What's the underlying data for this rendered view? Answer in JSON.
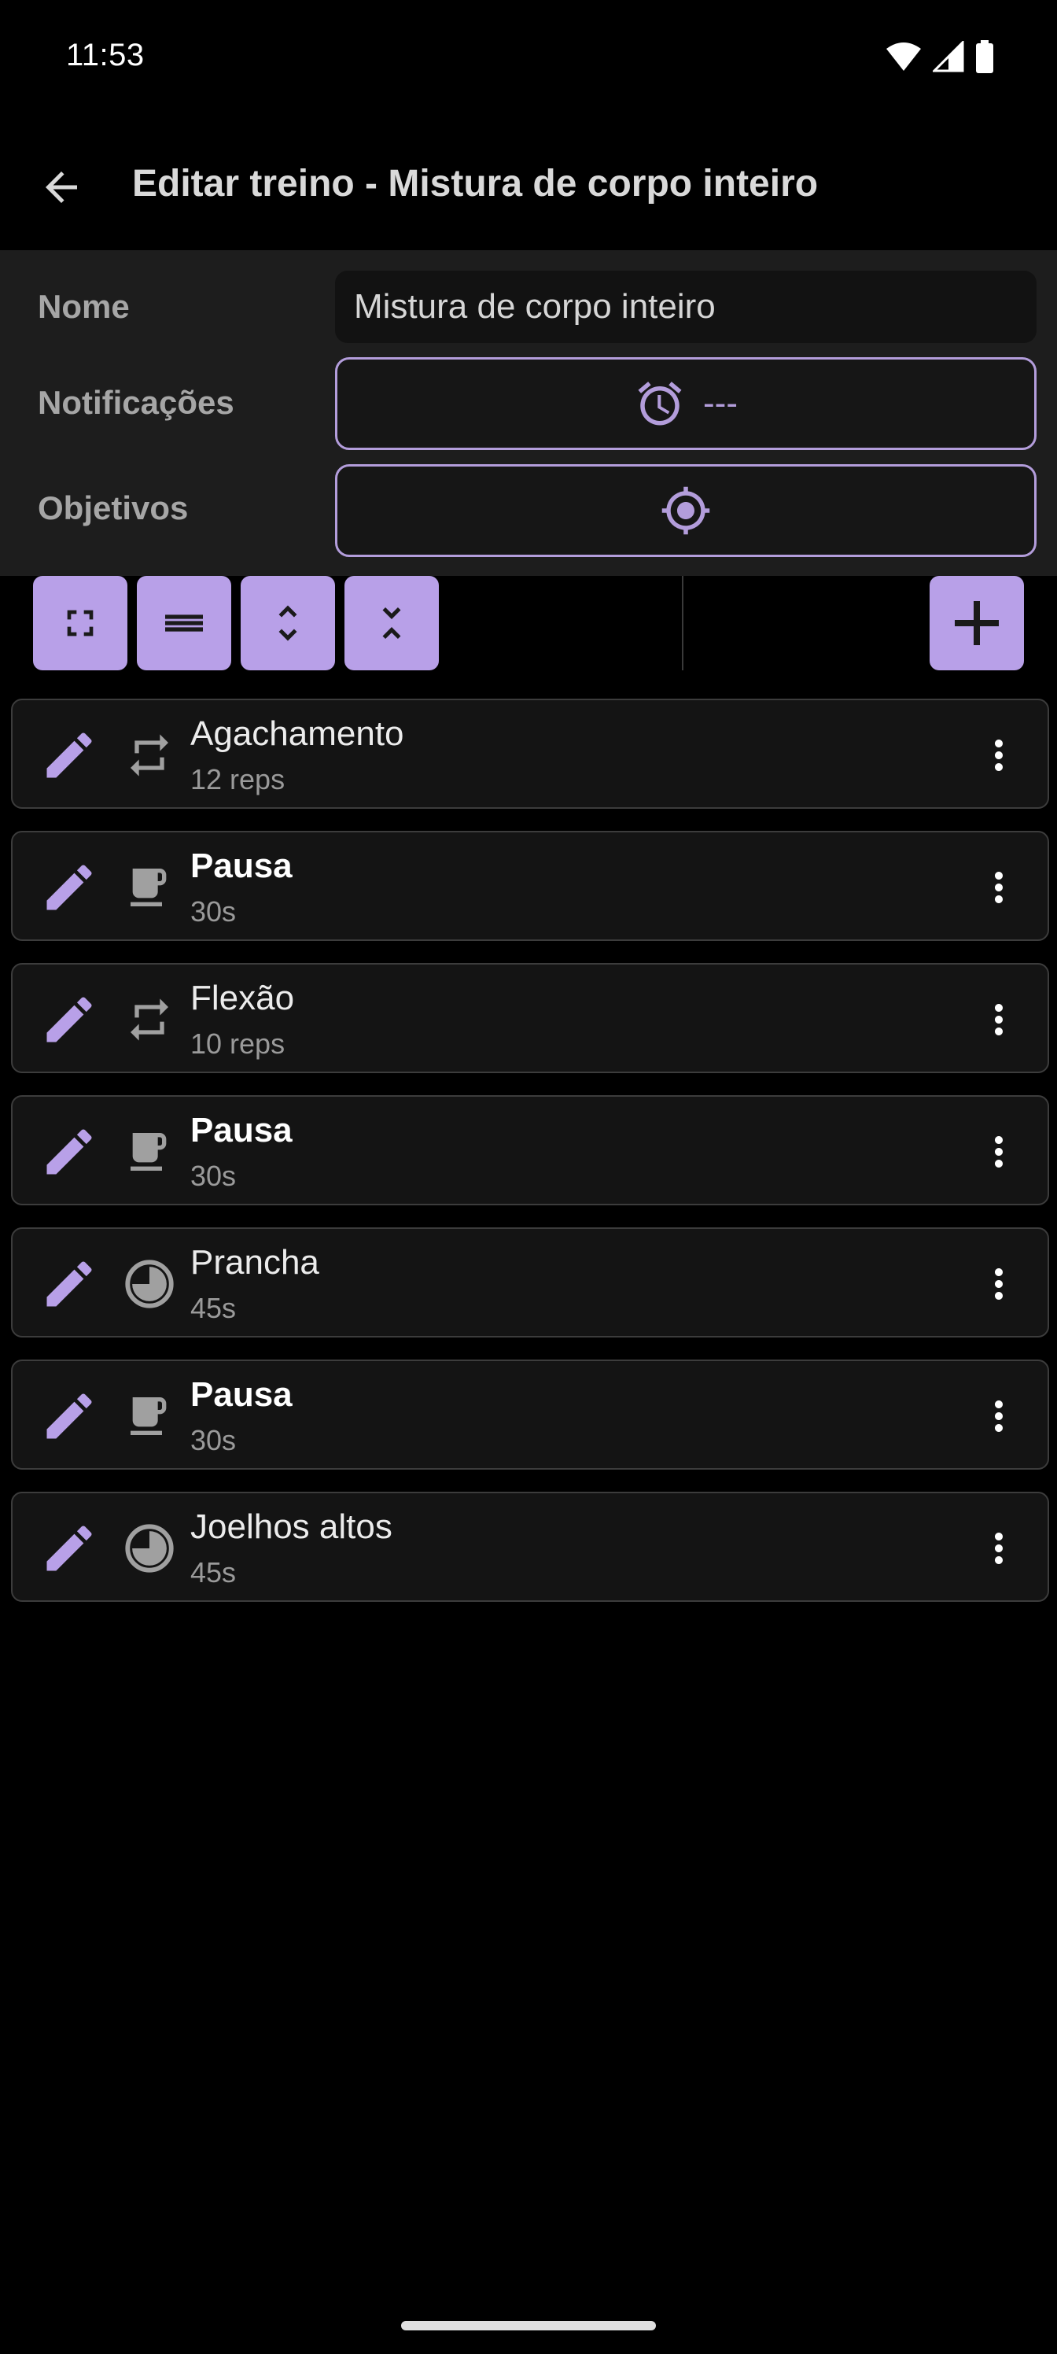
{
  "status_bar": {
    "time": "11:53"
  },
  "app_bar": {
    "title": "Editar treino - Mistura de corpo inteiro",
    "back_icon": "arrow-back-icon"
  },
  "form": {
    "name_label": "Nome",
    "name_value": "Mistura de corpo inteiro",
    "notifications_label": "Notificações",
    "notifications_value": "---",
    "goals_label": "Objetivos"
  },
  "toolbar": {
    "buttons": [
      "fullscreen-icon",
      "menu-lines-icon",
      "expand-icon",
      "collapse-icon"
    ],
    "add_icon": "plus-icon"
  },
  "exercises": [
    {
      "name": "Agachamento",
      "detail": "12 reps",
      "type": "repeat-icon",
      "bold": false
    },
    {
      "name": "Pausa",
      "detail": "30s",
      "type": "coffee-cup-icon",
      "bold": true
    },
    {
      "name": "Flexão",
      "detail": "10 reps",
      "type": "repeat-icon",
      "bold": false
    },
    {
      "name": "Pausa",
      "detail": "30s",
      "type": "coffee-cup-icon",
      "bold": true
    },
    {
      "name": "Prancha",
      "detail": "45s",
      "type": "timer-pie-icon",
      "bold": false
    },
    {
      "name": "Pausa",
      "detail": "30s",
      "type": "coffee-cup-icon",
      "bold": true
    },
    {
      "name": "Joelhos altos",
      "detail": "45s",
      "type": "timer-pie-icon",
      "bold": false
    }
  ],
  "colors": {
    "accent": "#b8a0e8",
    "background": "#000000",
    "panel": "#1d1d1d",
    "row_border": "#3c3c3c",
    "icon_gray": "#a0a0a0"
  }
}
